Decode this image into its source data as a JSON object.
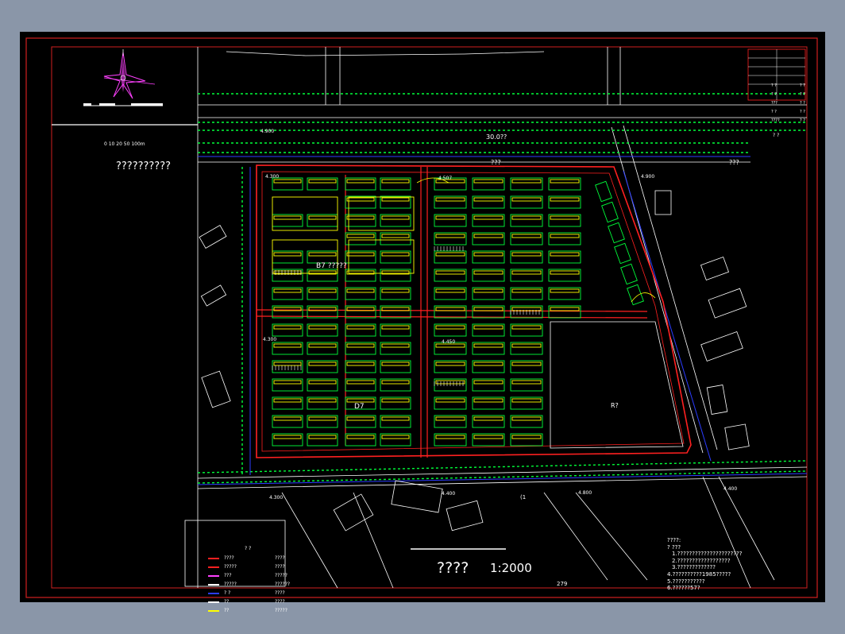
{
  "window": {
    "background_color": "#8a96a8",
    "canvas_color": "#000000"
  },
  "drawing": {
    "title": "??????????",
    "scale_label": "????",
    "scale_ratio": "1:2000",
    "scale_bar_numbers": "0  10 20      50          100m",
    "road_labels": {
      "north_road": "30.0??",
      "north_q1": "???",
      "north_q2": "???",
      "south_road": "(1"
    },
    "zone_labels": {
      "b": "B7 ?????",
      "d": "D7",
      "r": "R?"
    },
    "elevations": [
      "4.900",
      "4.300",
      "4.900",
      "4.507",
      "4.300",
      "4.450",
      "4.400",
      "4.800",
      "4.400",
      "4.300"
    ],
    "dimension_279": "279",
    "notes": {
      "heading": "????:",
      "lines": [
        "? ???",
        "1.??????????????????????",
        "2.??????????????????",
        "3.?????????????",
        "4.??????????1985?????",
        "5.???????????",
        "6.??????57?"
      ]
    },
    "legend": {
      "title": "? ?",
      "rows": [
        {
          "left": "????",
          "right": "????"
        },
        {
          "left": "?????",
          "right": "????"
        },
        {
          "left": "???",
          "right": "?????"
        },
        {
          "left": "?????",
          "right": "??????"
        },
        {
          "left": "?  ?",
          "right": "????"
        },
        {
          "left": "??",
          "right": "????"
        },
        {
          "left": "??",
          "right": "?????"
        }
      ]
    },
    "title_block": {
      "cells": [
        "? ?",
        "? ?",
        "? ?",
        "? ?",
        "???",
        "? ?",
        "? ?",
        "? ?",
        "????",
        "? ?"
      ],
      "extra": "? ?"
    },
    "colors": {
      "border": "#ff2020",
      "site_red": "#ff2020",
      "green": "#00ff3a",
      "yellow": "#ffff00",
      "blue": "#2b3cff",
      "white": "#ffffff",
      "magenta": "#ff40ff"
    },
    "icons": [
      "north-arrow-icon",
      "compass-rose-icon"
    ]
  }
}
